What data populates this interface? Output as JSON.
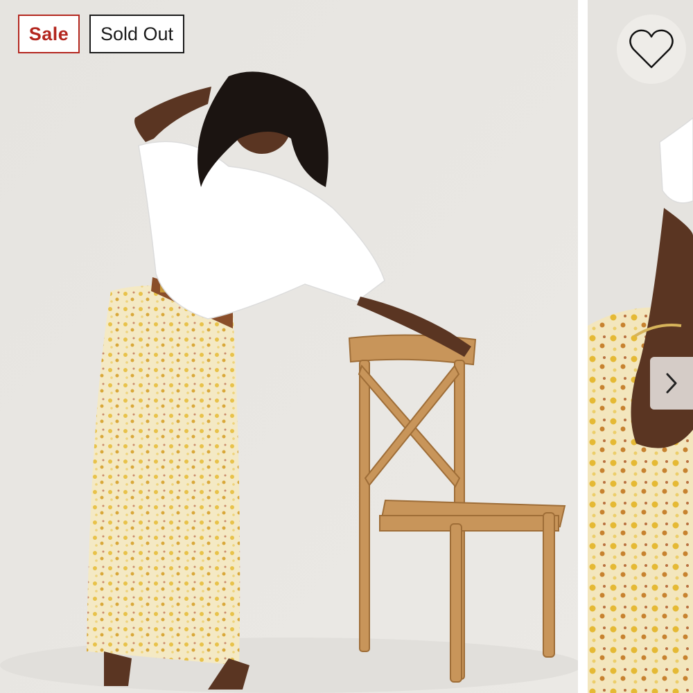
{
  "product_gallery": {
    "badges": {
      "sale_label": "Sale",
      "sold_out_label": "Sold Out"
    },
    "colors": {
      "sale_red": "#b3261e",
      "badge_border_dark": "#1a1a1a",
      "backdrop": "#e8e6e2"
    },
    "icons": {
      "wishlist": "heart-icon",
      "next": "chevron-right-icon"
    }
  }
}
